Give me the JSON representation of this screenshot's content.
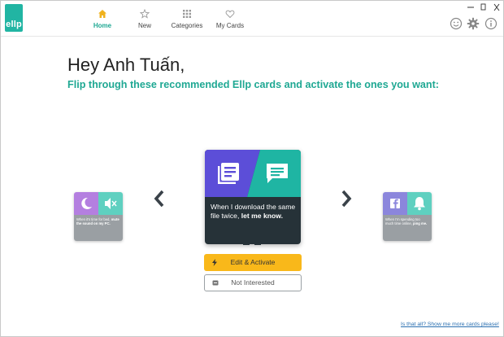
{
  "app": {
    "logo_text": "ellp",
    "brand_color": "#21b5a3",
    "accent_color": "#1fa893"
  },
  "nav": {
    "items": [
      {
        "label": "Home",
        "icon": "home-icon",
        "active": true
      },
      {
        "label": "New",
        "icon": "star-icon",
        "active": false
      },
      {
        "label": "Categories",
        "icon": "grid-icon",
        "active": false
      },
      {
        "label": "My Cards",
        "icon": "heart-icon",
        "active": false
      }
    ]
  },
  "window_controls": [
    "minimize-icon",
    "restore-icon",
    "close-icon"
  ],
  "toolbar_icons": [
    "smiley-icon",
    "gear-icon",
    "info-icon"
  ],
  "greeting": "Hey Anh Tuấn,",
  "subtitle": "Flip through these recommended Ellp cards and activate the ones you want:",
  "cards": {
    "left": {
      "text_plain": "When it's time for bed, ",
      "text_bold": "mute the sound on my PC.",
      "icons": [
        "moon-icon",
        "mute-icon"
      ]
    },
    "main": {
      "text_plain": "When I download the same file twice, ",
      "text_bold": "let me know.",
      "icons": [
        "document-list-icon",
        "message-icon"
      ],
      "colors": {
        "left": "#5c4ed8",
        "right": "#1fb5a3",
        "body": "#263238"
      }
    },
    "right": {
      "text_plain": "When I'm spending too much time online, ",
      "text_bold": "ping me.",
      "icons": [
        "facebook-icon",
        "bell-icon"
      ]
    }
  },
  "buttons": {
    "activate": "Edit & Activate",
    "not_interested": "Not Interested"
  },
  "more_link": "Is that all? Show me more cards please!"
}
